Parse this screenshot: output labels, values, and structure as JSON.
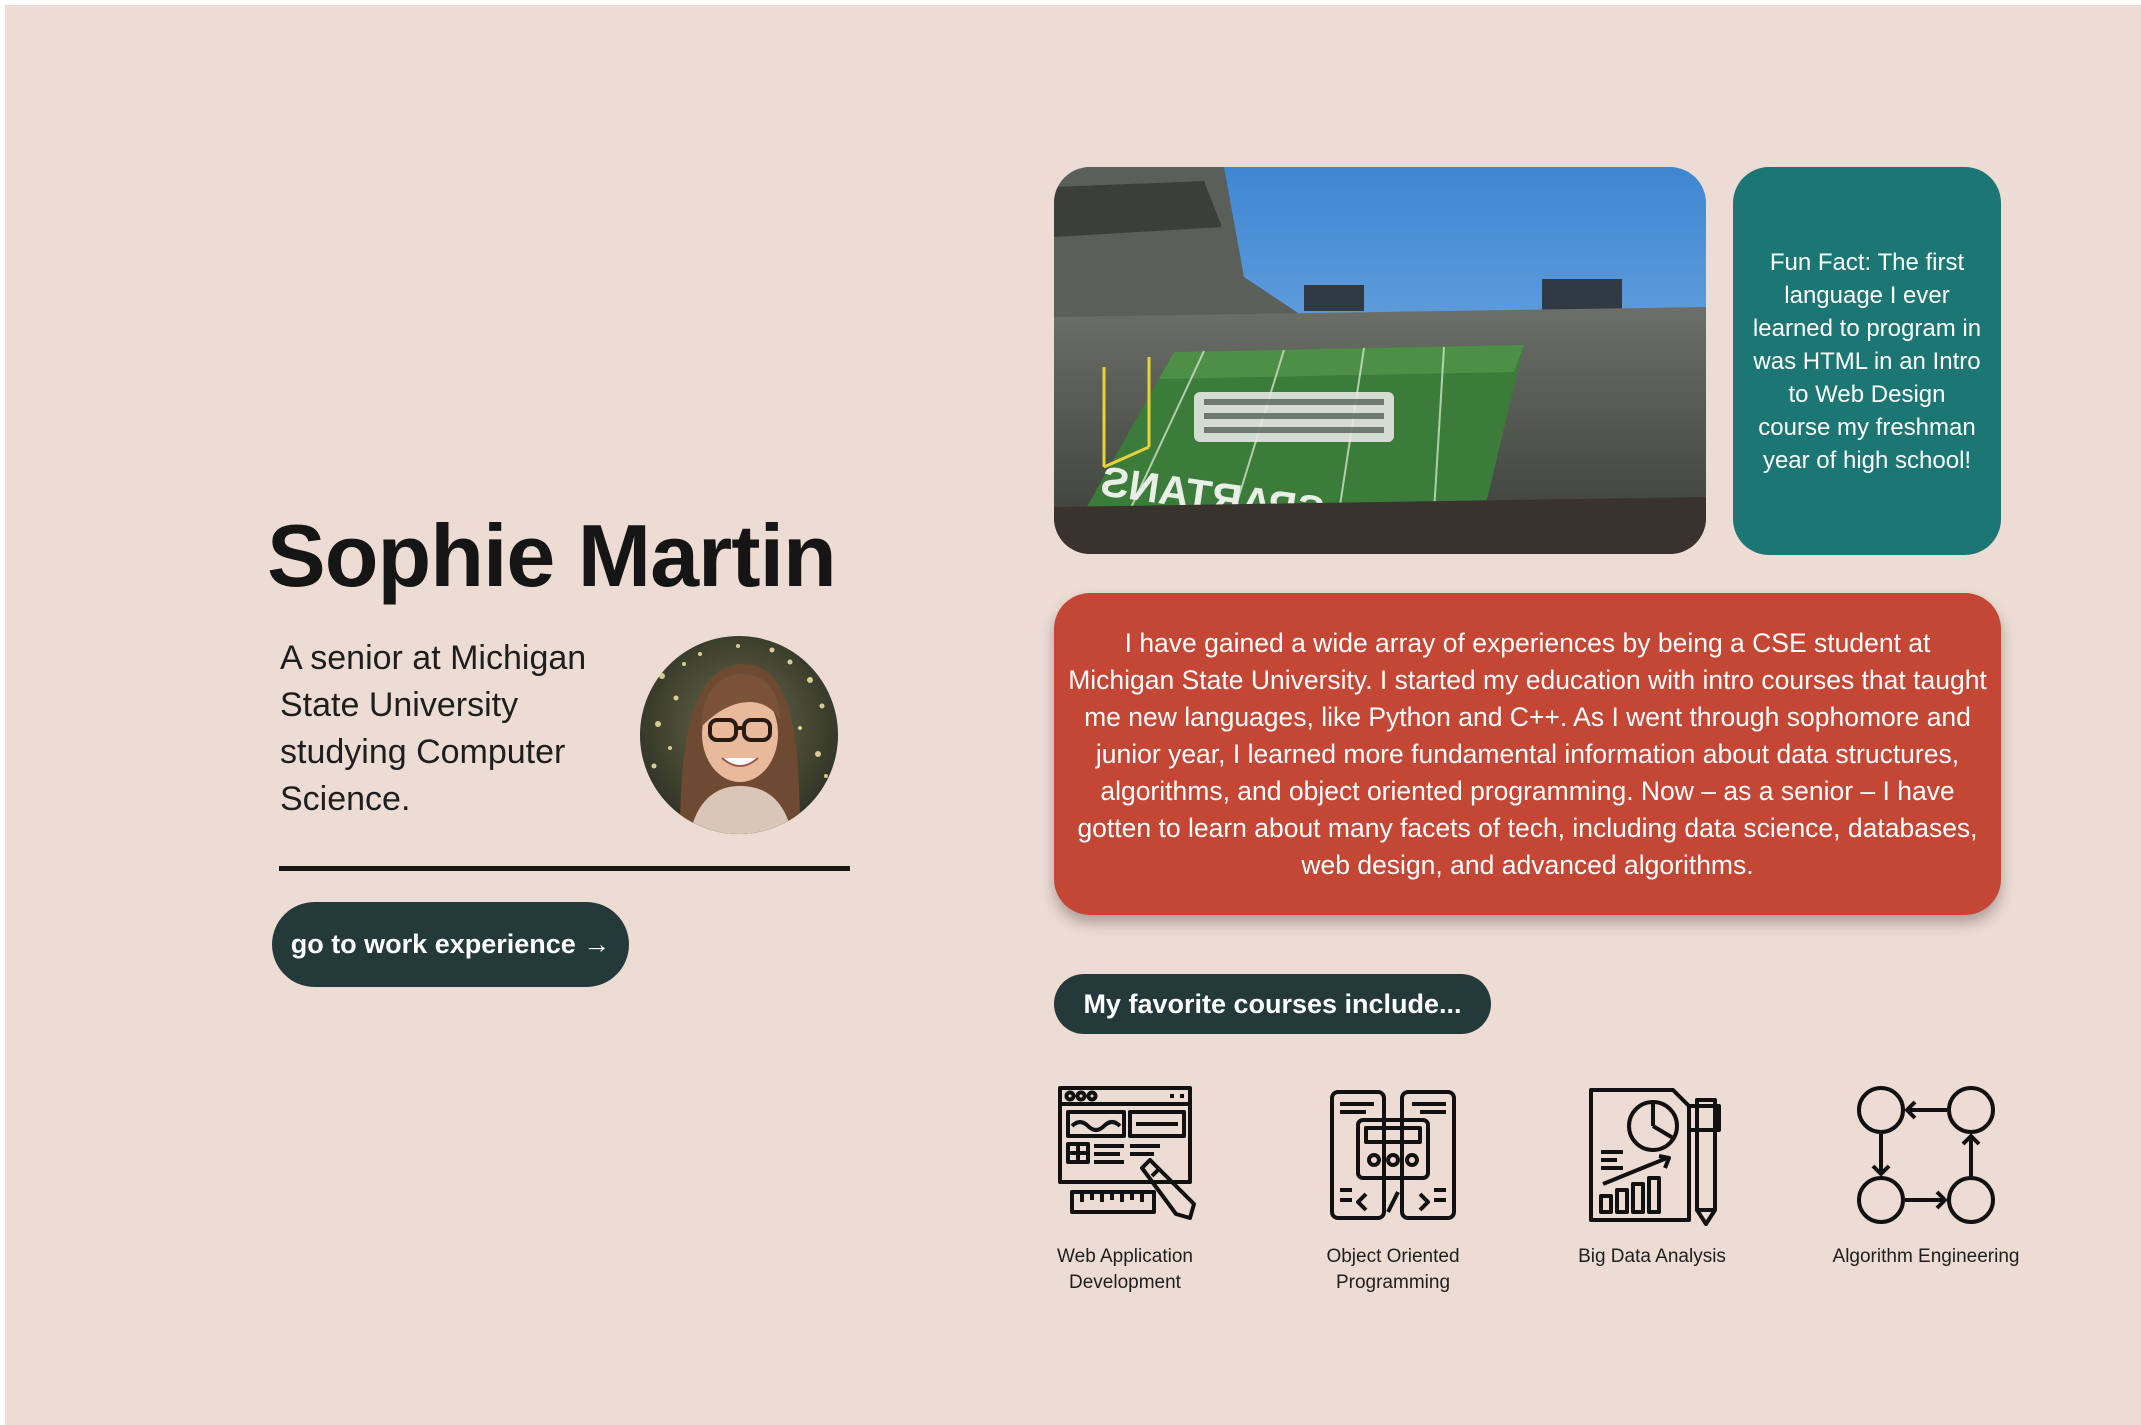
{
  "profile": {
    "name": "Sophie Martin",
    "tagline": "A senior at Michigan State University studying Computer Science."
  },
  "cta": {
    "label": "go to work experience →"
  },
  "fun_fact": "Fun Fact: The first language I ever learned to program in was HTML in an Intro to Web Design course my freshman year of high school!",
  "experience": "I have gained a wide array of experiences by being a CSE student at Michigan State University. I started my education with intro courses that taught me new languages, like Python and C++. As I went through sophomore and junior year, I learned more fundamental information about data structures, algorithms, and object oriented programming. Now – as a senior – I have gotten to learn about many facets of tech, including data science, databases, web design, and advanced algorithms.",
  "courses": {
    "label": "My favorite courses include...",
    "items": [
      {
        "name": "Web Application Development",
        "icon": "web-development-icon"
      },
      {
        "name": "Object Oriented Programming",
        "icon": "code-blocks-icon"
      },
      {
        "name": "Big Data Analysis",
        "icon": "data-report-icon"
      },
      {
        "name": "Algorithm Engineering",
        "icon": "algorithm-cycle-icon"
      }
    ]
  },
  "colors": {
    "background": "#eddcd3",
    "dark_teal": "#23393a",
    "teal": "#1b7674",
    "red": "#c44634"
  }
}
